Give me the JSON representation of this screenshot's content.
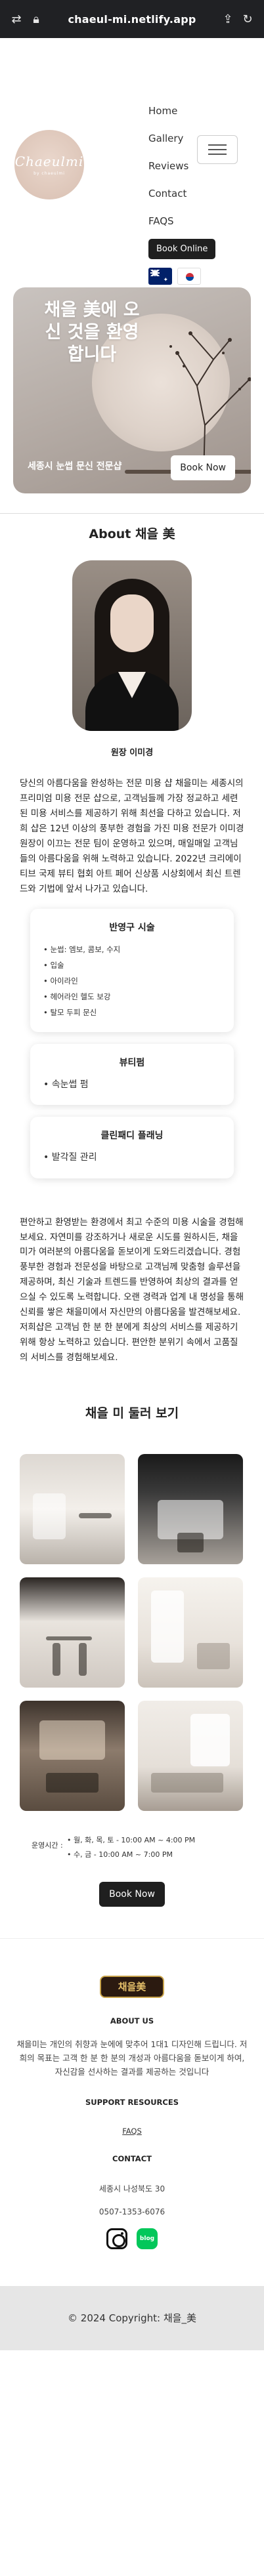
{
  "browser": {
    "url": "chaeul-mi.netlify.app"
  },
  "header": {
    "logo_text": "Chaeulmi",
    "logo_sub": "by chaeulmi",
    "nav": [
      "Home",
      "Gallery",
      "Reviews",
      "Contact",
      "FAQS"
    ],
    "book_online": "Book Online",
    "languages": [
      "English",
      "한국어"
    ]
  },
  "hero": {
    "title": "채을 美에 오신 것을 환영합니다",
    "subtitle": "세종시 눈썹 문신 전문샵",
    "book_now": "Book Now"
  },
  "about": {
    "title": "About 채을 美",
    "caption": "원장 이미경",
    "paragraph1": "당신의 아름다움을 완성하는 전문 미용 샵 채을미는 세종시의 프리미엄 미용 전문 샵으로, 고객님들께 가장 정교하고 세련된 미용 서비스를 제공하기 위해 최선을 다하고 있습니다. 저희 샵은 12년 이상의 풍부한 경험을 가진 미용 전문가 이미경 원장이 이끄는 전문 팀이 운영하고 있으며, 매일매일 고객님들의 아름다움을 위해 노력하고 있습니다. 2022년 크리에이티브 국제 뷰티 협회 아트 페어 신상품 시상회에서 최신 트렌드와 기법에 앞서 나가고 있습니다.",
    "cards": [
      {
        "title": "반영구 시술",
        "items": [
          "눈썹: 엠보, 콤보, 수지",
          "입술",
          "아이라인",
          "헤어라인 헬도 보강",
          "탈모 두피 문신"
        ]
      },
      {
        "title": "뷰티펌",
        "items": [
          "속눈썹 펌"
        ]
      },
      {
        "title": "클린패디 플래닝",
        "items": [
          "발각질 관리"
        ]
      }
    ],
    "paragraph2": "편안하고 환영받는 환경에서 최고 수준의 미용 시술을 경험해 보세요. 자연미를 강조하거나 새로운 시도를 원하시든, 채을미가 여러분의 아름다움을 돋보이게 도와드리겠습니다. 경험 풍부한 경험과 전문성을 바탕으로 고객님께 맞춤형 솔루션을 제공하며, 최신 기술과 트렌드를 반영하여 최상의 결과를 얻으실 수 있도록 노력합니다. 오랜 경력과 업계 내 명성을 통해 신뢰를 쌓은 채을미에서 자신만의 아름다움을 발견해보세요. 저희샵은 고객님 한 분 한 분에게 최상의 서비스를 제공하기 위해 항상 노력하고 있습니다. 편안한 분위기 속에서 고품질의 서비스를 경험해보세요."
  },
  "gallery": {
    "title": "채을 미 둘러 보기",
    "image_names": [
      "salon-interior-1",
      "salon-interior-2",
      "salon-interior-3",
      "salon-interior-4",
      "salon-interior-5",
      "salon-interior-6"
    ]
  },
  "hours": {
    "label": "운영시간 :",
    "lines": [
      "월, 화, 목, 토 - 10:00 AM ~ 4:00 PM",
      "수, 금 - 10:00 AM ~ 7:00 PM"
    ],
    "book_now": "Book Now"
  },
  "footer": {
    "logo_text": "채을美",
    "about_heading": "ABOUT US",
    "about_text": "채을미는 개인의 취향과 눈에에 맞추어 1대1 디자인해 드립니다. 저희의 목표는 고객 한 분 한 분의 개성과 아름다움을 돋보이게 하여, 자신감을 선사하는 결과를 제공하는 것입니다",
    "support_heading": "SUPPORT RESOURCES",
    "faqs_link": "FAQS",
    "contact_heading": "CONTACT",
    "address": "세종시 나성북도 30",
    "phone": "0507-1353-6076",
    "blog_label": "blog",
    "copyright": "© 2024 Copyright: 채을_美"
  },
  "colors": {
    "dark": "#1f1f1f",
    "logo_bg": "#d8bfb1",
    "blog_green": "#03c75a"
  }
}
